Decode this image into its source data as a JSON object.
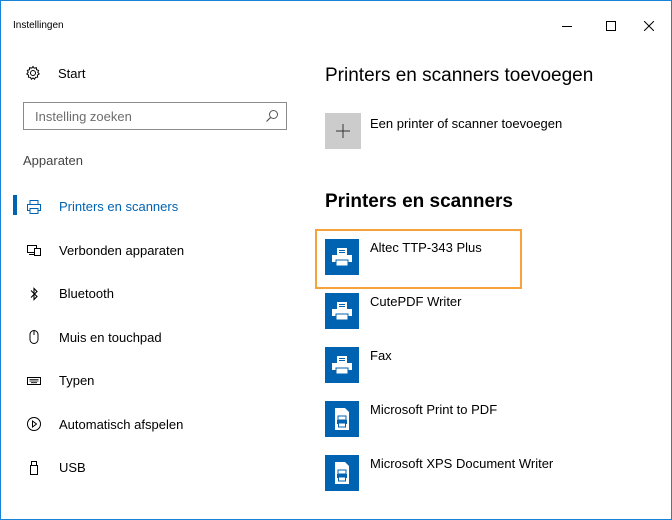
{
  "window": {
    "title": "Instellingen"
  },
  "sidebar": {
    "home_label": "Start",
    "search_placeholder": "Instelling zoeken",
    "section_label": "Apparaten",
    "items": [
      {
        "label": "Printers en scanners",
        "icon": "printer-icon",
        "active": true
      },
      {
        "label": "Verbonden apparaten",
        "icon": "devices-icon",
        "active": false
      },
      {
        "label": "Bluetooth",
        "icon": "bluetooth-icon",
        "active": false
      },
      {
        "label": "Muis en touchpad",
        "icon": "mouse-icon",
        "active": false
      },
      {
        "label": "Typen",
        "icon": "keyboard-icon",
        "active": false
      },
      {
        "label": "Automatisch afspelen",
        "icon": "autoplay-icon",
        "active": false
      },
      {
        "label": "USB",
        "icon": "usb-icon",
        "active": false
      }
    ]
  },
  "main": {
    "add_heading": "Printers en scanners toevoegen",
    "add_label": "Een printer of scanner toevoegen",
    "list_heading": "Printers en scanners",
    "printers": [
      {
        "name": "Altec TTP-343 Plus",
        "icon": "printer-icon",
        "highlighted": true
      },
      {
        "name": "CutePDF Writer",
        "icon": "printer-icon",
        "highlighted": false
      },
      {
        "name": "Fax",
        "icon": "printer-icon",
        "highlighted": false
      },
      {
        "name": "Microsoft Print to PDF",
        "icon": "document-printer-icon",
        "highlighted": false
      },
      {
        "name": "Microsoft XPS Document Writer",
        "icon": "document-printer-icon",
        "highlighted": false
      }
    ]
  },
  "colors": {
    "accent": "#0063b1",
    "highlight": "#f7a23b",
    "border": "#1883d7"
  }
}
